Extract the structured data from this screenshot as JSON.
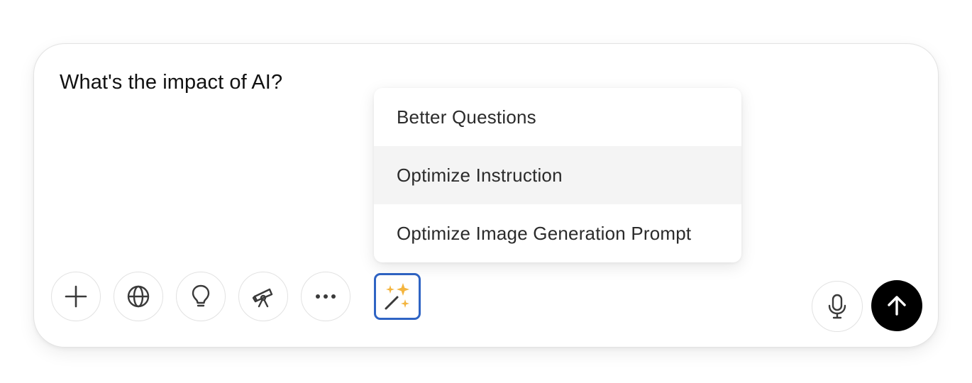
{
  "composer": {
    "prompt_text": "What's the impact of AI?"
  },
  "toolbar": {
    "buttons": [
      {
        "name": "add-button",
        "icon": "plus-icon"
      },
      {
        "name": "web-search-button",
        "icon": "globe-icon"
      },
      {
        "name": "reasoning-button",
        "icon": "lightbulb-icon"
      },
      {
        "name": "deep-research-button",
        "icon": "telescope-icon"
      },
      {
        "name": "more-tools-button",
        "icon": "ellipsis-icon"
      },
      {
        "name": "prompt-optimize-button",
        "icon": "magic-wand-sparkles-icon"
      }
    ],
    "right_buttons": [
      {
        "name": "voice-input-button",
        "icon": "microphone-icon"
      },
      {
        "name": "send-button",
        "icon": "arrow-up-icon"
      }
    ]
  },
  "optimize_menu": {
    "items": [
      {
        "label": "Better Questions"
      },
      {
        "label": "Optimize Instruction"
      },
      {
        "label": "Optimize Image Generation Prompt"
      }
    ],
    "hovered_index": 1
  },
  "colors": {
    "focus_border": "#2f64c4",
    "sparkle": "#f4b53f",
    "send_bg": "#000000",
    "menu_hover_bg": "#f4f4f4"
  }
}
